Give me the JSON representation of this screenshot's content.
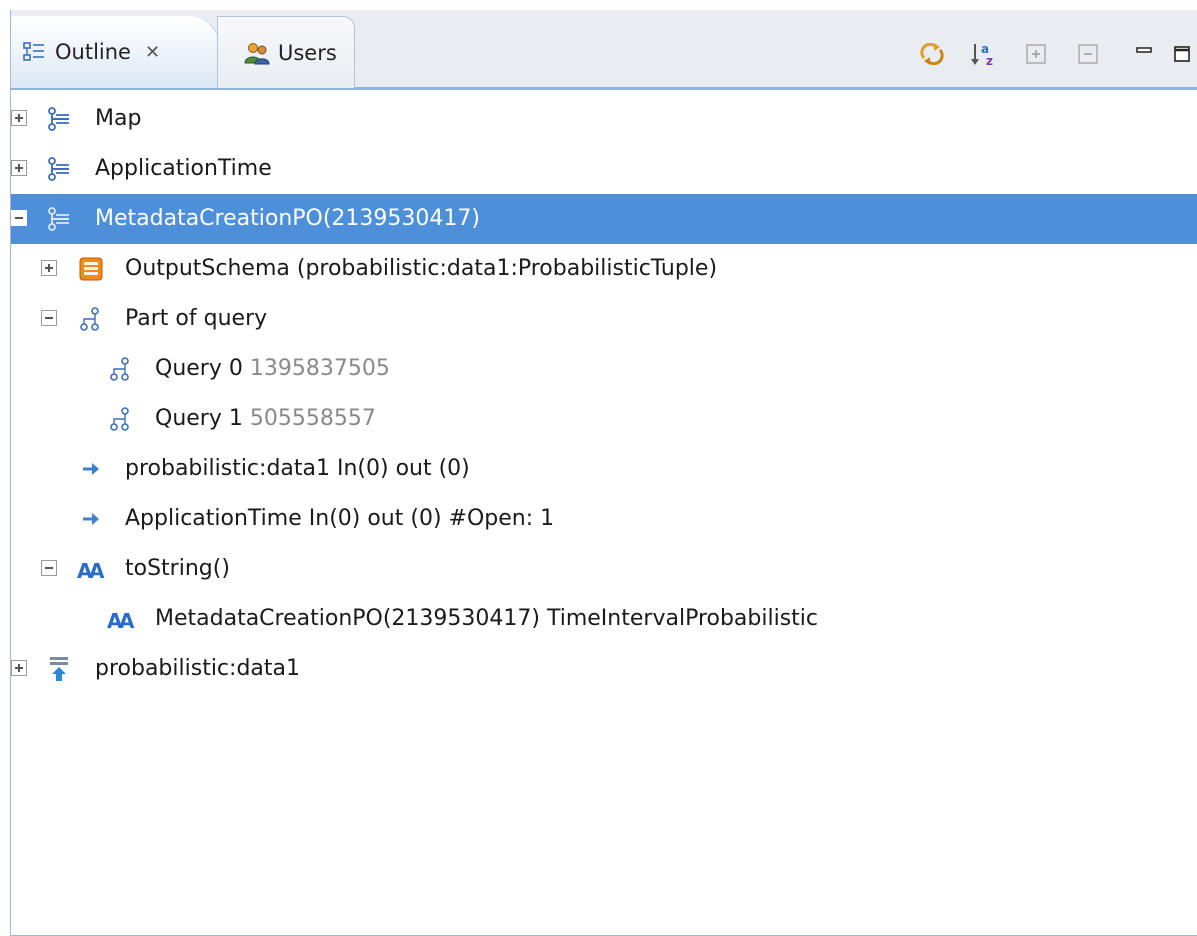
{
  "tabs": {
    "outline": {
      "label": "Outline",
      "close_glyph": "✕",
      "icon": "outline-icon"
    },
    "users": {
      "label": "Users",
      "icon": "users-icon"
    }
  },
  "toolbar": {
    "buttons": [
      "sync-icon",
      "sort-az-icon",
      "expand-all-icon",
      "collapse-all-icon",
      "minimize-icon",
      "maximize-icon"
    ]
  },
  "tree": {
    "map": {
      "label": "Map",
      "icon": "operator-icon",
      "expanded": false
    },
    "application_time": {
      "label": "ApplicationTime",
      "icon": "operator-icon",
      "expanded": false
    },
    "metadata_creation": {
      "label": "MetadataCreationPO(2139530417)",
      "icon": "operator-icon",
      "expanded": true,
      "selected": true
    },
    "output_schema": {
      "label": "OutputSchema (probabilistic:data1:ProbabilisticTuple)",
      "icon": "schema-icon",
      "expanded": false
    },
    "part_of_query": {
      "label": "Part of query",
      "icon": "query-tree-icon",
      "expanded": true
    },
    "query0": {
      "label": "Query 0",
      "id": "1395837505",
      "icon": "query-tree-icon"
    },
    "query1": {
      "label": "Query 1",
      "id": "505558557",
      "icon": "query-tree-icon"
    },
    "port1": {
      "label": "probabilistic:data1 In(0) out (0)",
      "icon": "arrow-right-icon"
    },
    "port2": {
      "label": "ApplicationTime In(0) out (0) #Open: 1",
      "icon": "arrow-right-icon"
    },
    "to_string": {
      "label": "toString()",
      "icon": "text-aa-icon",
      "expanded": true
    },
    "to_string_value": {
      "label": "MetadataCreationPO(2139530417) TimeIntervalProbabilistic",
      "icon": "text-aa-icon"
    },
    "source": {
      "label": "probabilistic:data1",
      "icon": "source-icon",
      "expanded": false
    }
  },
  "colors": {
    "selection": "#4d8fd9",
    "tab_border": "#8fb4de",
    "icon_blue": "#3d6fb8"
  }
}
